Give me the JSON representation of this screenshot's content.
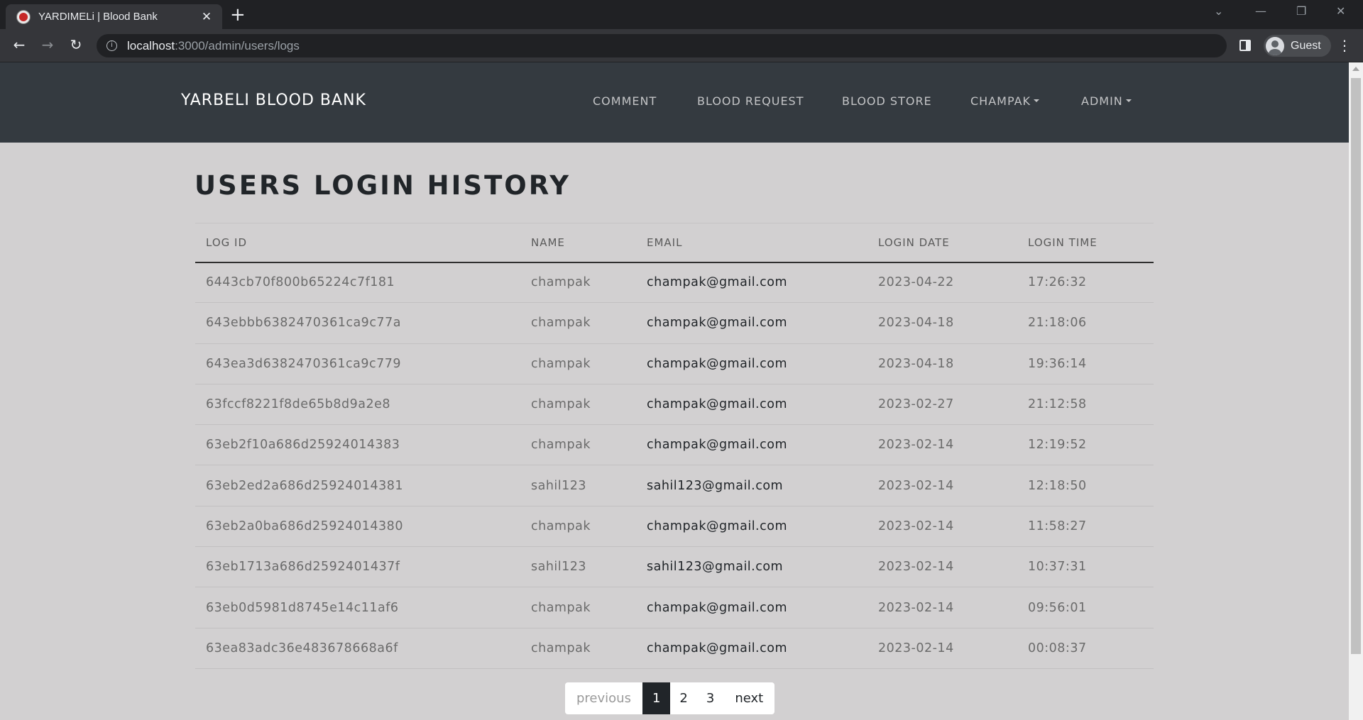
{
  "browser": {
    "tab_title": "YARDIMELi | Blood Bank",
    "url_host": "localhost",
    "url_path": ":3000/admin/users/logs",
    "profile_label": "Guest"
  },
  "navbar": {
    "brand": "YARBELI BLOOD BANK",
    "links": [
      "COMMENT",
      "BLOOD REQUEST",
      "BLOOD STORE",
      "CHAMPAK",
      "ADMIN"
    ]
  },
  "page": {
    "title": "USERS LOGIN HISTORY"
  },
  "table": {
    "headers": [
      "LOG ID",
      "NAME",
      "EMAIL",
      "LOGIN DATE",
      "LOGIN TIME"
    ],
    "rows": [
      [
        "6443cb70f800b65224c7f181",
        "champak",
        "champak@gmail.com",
        "2023-04-22",
        "17:26:32"
      ],
      [
        "643ebbb6382470361ca9c77a",
        "champak",
        "champak@gmail.com",
        "2023-04-18",
        "21:18:06"
      ],
      [
        "643ea3d6382470361ca9c779",
        "champak",
        "champak@gmail.com",
        "2023-04-18",
        "19:36:14"
      ],
      [
        "63fccf8221f8de65b8d9a2e8",
        "champak",
        "champak@gmail.com",
        "2023-02-27",
        "21:12:58"
      ],
      [
        "63eb2f10a686d25924014383",
        "champak",
        "champak@gmail.com",
        "2023-02-14",
        "12:19:52"
      ],
      [
        "63eb2ed2a686d25924014381",
        "sahil123",
        "sahil123@gmail.com",
        "2023-02-14",
        "12:18:50"
      ],
      [
        "63eb2a0ba686d25924014380",
        "champak",
        "champak@gmail.com",
        "2023-02-14",
        "11:58:27"
      ],
      [
        "63eb1713a686d2592401437f",
        "sahil123",
        "sahil123@gmail.com",
        "2023-02-14",
        "10:37:31"
      ],
      [
        "63eb0d5981d8745e14c11af6",
        "champak",
        "champak@gmail.com",
        "2023-02-14",
        "09:56:01"
      ],
      [
        "63ea83adc36e483678668a6f",
        "champak",
        "champak@gmail.com",
        "2023-02-14",
        "00:08:37"
      ]
    ]
  },
  "pagination": {
    "previous": "previous",
    "pages": [
      "1",
      "2",
      "3"
    ],
    "next": "next",
    "active_page": "1"
  },
  "colors": {
    "navbar_bg": "#343a40",
    "page_bg": "#d2d0d1",
    "active_page_bg": "#212529"
  }
}
